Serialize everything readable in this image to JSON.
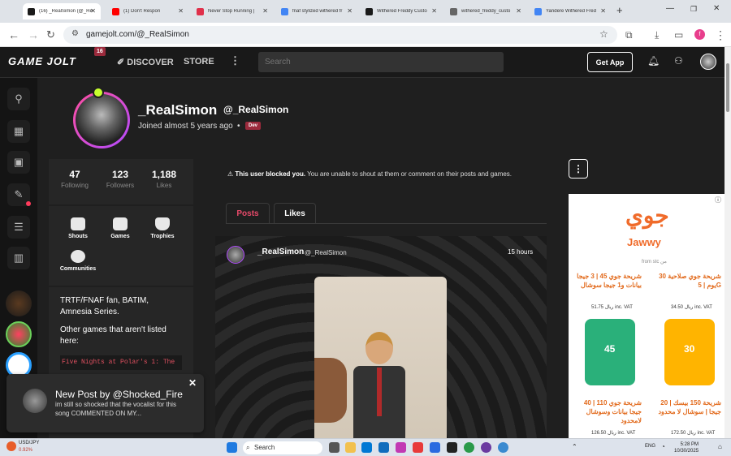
{
  "browser": {
    "tabs": [
      {
        "title": "(16) _RealSimon (@_Re",
        "color": "#1a1a1a"
      },
      {
        "title": "(1) Don't Respon",
        "color": "#ff0000"
      },
      {
        "title": "Never Stop Running | ",
        "color": "#e0304a"
      },
      {
        "title": "fnaf stylized withered fr",
        "color": "#4285f4"
      },
      {
        "title": "Withered Freddy Custo",
        "color": "#1a1a1a"
      },
      {
        "title": "withered_freddy_custo",
        "color": "#666666"
      },
      {
        "title": "Yandere Withered Fred",
        "color": "#4285f4"
      }
    ],
    "url": "gamejolt.com/@_RealSimon",
    "profile_initial": "f"
  },
  "header": {
    "logo": "GAME JOLT",
    "badge": "16",
    "discover": "DISCOVER",
    "store": "STORE",
    "search_placeholder": "Search",
    "get_app": "Get App"
  },
  "profile": {
    "display_name": "_RealSimon",
    "username": "@_RealSimon",
    "joined": "Joined almost 5 years ago",
    "dev_badge": "Dev",
    "stats": [
      {
        "value": "47",
        "label": "Following"
      },
      {
        "value": "123",
        "label": "Followers"
      },
      {
        "value": "1,188",
        "label": "Likes"
      }
    ],
    "sections": [
      "Shouts",
      "Games",
      "Trophies",
      "Communities"
    ],
    "bio_line1": "TRTF/FNAF fan, BATIM, Amnesia Series.",
    "bio_line2": "Other games that aren't listed here:",
    "bio_code": "Five Nights at Polar's 1: The"
  },
  "blocked": {
    "bold": "This user blocked you.",
    "rest": " You are unable to shout at them or comment on their posts and games."
  },
  "tabs": {
    "posts": "Posts",
    "likes": "Likes"
  },
  "post": {
    "author": "_RealSimon",
    "handle": "@_RealSimon",
    "time": "15 hours"
  },
  "ad": {
    "logo": "جوي",
    "brand": "Jawwy",
    "from": "from stc من",
    "offer1": "شريحة جوي 45 | 3 جيجا بيانات و1 جيجا سوشال",
    "offer2": "شريحة جوي صلاحية 30 يوم | 5G",
    "price1": "51.75 ريال inc. VAT",
    "price2": "34.50 ريال inc. VAT",
    "sim1_num": "45",
    "sim2_num": "30",
    "offer3": "شريحة جوي 110 | 40 جيجا بيانات وسوشال لامحدود",
    "offer4": "شريحة 150 بيسك | 20 جيجا | سوشال لا محدود",
    "price3": "126.50 ريال inc. VAT",
    "price4": "172.50 ريال inc. VAT"
  },
  "notification": {
    "title": "New Post by @Shocked_Fire",
    "body": "im still so shocked that the vocalist for this song COMMENTED ON MY..."
  },
  "taskbar": {
    "ticker_name": "USD/JPY",
    "ticker_value": "0.92%",
    "search": "Search",
    "lang": "ENG",
    "time": "5:28 PM",
    "date": "10/30/2025"
  }
}
